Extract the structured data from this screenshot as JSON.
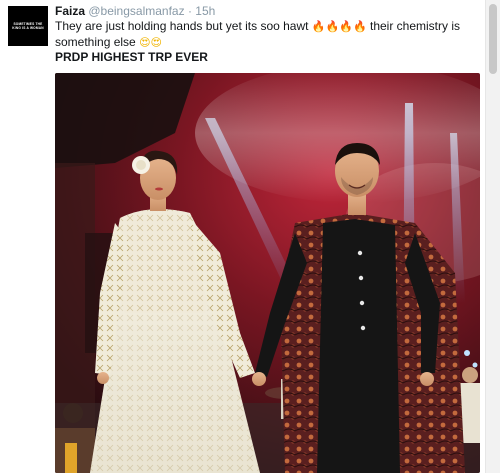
{
  "tweet": {
    "avatar_text": "SOMETIMES THE\nKING IS A WOMAN",
    "name": "Faiza",
    "handle": "@beingsalmanfaz",
    "separator": "·",
    "time": "15h",
    "text_part1": "They are just holding hands but yet its soo hawt",
    "text_part2": "their chemistry is something else",
    "text_line2": "PRDP HIGHEST TRP EVER",
    "emoji_fire": "🔥",
    "emoji_heart_eyes": "😍"
  },
  "photo": {
    "subject": "fashion-runway-photo"
  }
}
